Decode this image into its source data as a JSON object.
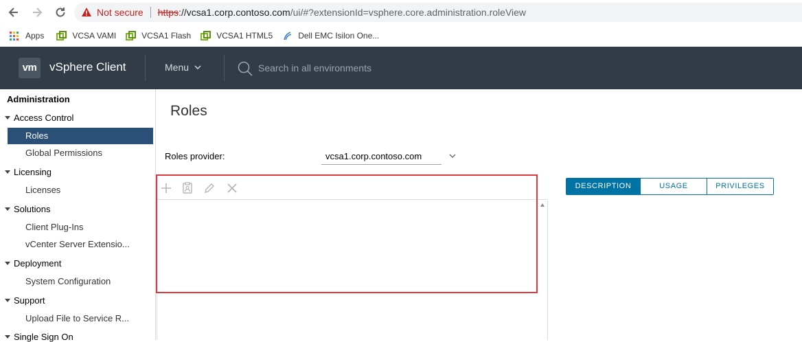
{
  "browser": {
    "security_text": "Not secure",
    "url_proto": "https",
    "url_host": "://vcsa1.corp.contoso.com",
    "url_rest": "/ui/#?extensionId=vsphere.core.administration.roleView",
    "bookmarks": [
      {
        "label": "Apps"
      },
      {
        "label": "VCSA VAMI"
      },
      {
        "label": "VCSA1 Flash"
      },
      {
        "label": "VCSA1 HTML5"
      },
      {
        "label": "Dell EMC Isilon One..."
      }
    ]
  },
  "header": {
    "logo_text": "vm",
    "app_title": "vSphere Client",
    "menu_label": "Menu",
    "search_placeholder": "Search in all environments"
  },
  "sidebar": {
    "title": "Administration",
    "sections": [
      {
        "label": "Access Control",
        "items": [
          "Roles",
          "Global Permissions"
        ]
      },
      {
        "label": "Licensing",
        "items": [
          "Licenses"
        ]
      },
      {
        "label": "Solutions",
        "items": [
          "Client Plug-Ins",
          "vCenter Server Extensio..."
        ]
      },
      {
        "label": "Deployment",
        "items": [
          "System Configuration"
        ]
      },
      {
        "label": "Support",
        "items": [
          "Upload File to Service R..."
        ]
      },
      {
        "label": "Single Sign On",
        "items": []
      }
    ],
    "active_item": "Roles"
  },
  "main": {
    "title": "Roles",
    "roles_provider_label": "Roles provider:",
    "roles_provider_value": "vcsa1.corp.contoso.com",
    "tabs": [
      {
        "label": "DESCRIPTION",
        "active": true
      },
      {
        "label": "USAGE",
        "active": false
      },
      {
        "label": "PRIVILEGES",
        "active": false
      }
    ]
  },
  "colors": {
    "header_bg": "#313c47",
    "sidebar_active": "#2b5077",
    "tab_accent": "#0072a3",
    "highlight_red": "#e0383e"
  }
}
